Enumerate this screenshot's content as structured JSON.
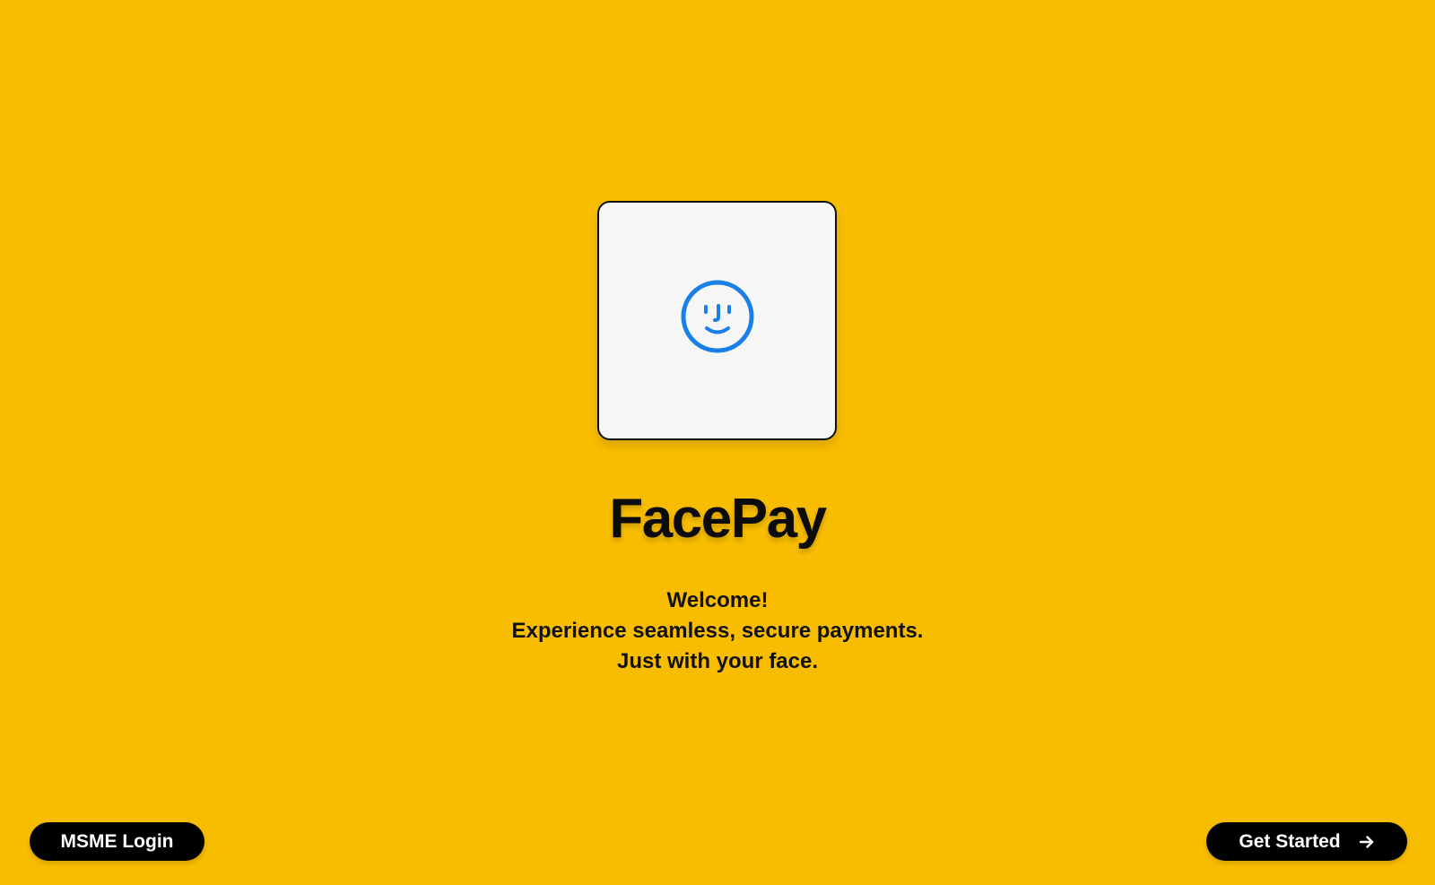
{
  "colors": {
    "background": "#F8BD00",
    "card_background": "#F6F6F6",
    "face_icon": "#1A7FE6",
    "button_background": "#000000",
    "button_text": "#FFFFFF"
  },
  "logo": {
    "icon": "face-id-icon"
  },
  "app": {
    "title": "FacePay"
  },
  "tagline": {
    "lines": [
      "Welcome!",
      "Experience seamless, secure payments.",
      "Just with your face."
    ]
  },
  "footer": {
    "msme_login_label": "MSME Login",
    "get_started_label": "Get Started",
    "get_started_icon": "arrow-right-icon"
  }
}
